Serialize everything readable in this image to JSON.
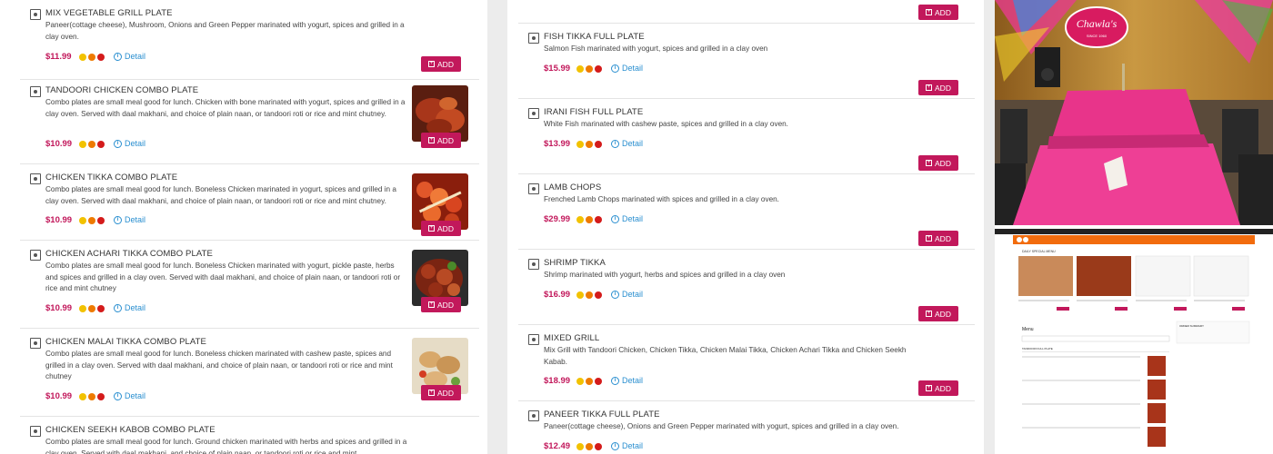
{
  "left_items": [
    {
      "name": "MIX VEGETABLE GRILL PLATE",
      "desc": "Paneer(cottage cheese), Mushroom, Onions and Green Pepper marinated with yogurt, spices and grilled in a clay oven.",
      "price": "$11.99",
      "detail": "Detail",
      "add": "ADD"
    },
    {
      "name": "TANDOORI CHICKEN COMBO PLATE",
      "desc": "Combo plates are small meal good for lunch. Chicken with bone marinated with yogurt, spices and grilled in a clay oven. Served with daal makhani, and choice of plain naan, or tandoori roti or rice and mint chutney.",
      "price": "$10.99",
      "detail": "Detail",
      "add": "ADD"
    },
    {
      "name": "CHICKEN TIKKA COMBO PLATE",
      "desc": "Combo plates are small meal good for lunch. Boneless Chicken marinated in yogurt, spices and grilled in a clay oven. Served with daal makhani, and choice of plain naan, or tandoori roti or rice and mint chutney.",
      "price": "$10.99",
      "detail": "Detail",
      "add": "ADD"
    },
    {
      "name": "CHICKEN ACHARI TIKKA COMBO PLATE",
      "desc": "Combo plates are small meal good for lunch. Boneless Chicken marinated with yogurt, pickle paste, herbs and spices and grilled in a clay oven. Served with daal makhani, and choice of plain naan, or tandoori roti or rice and mint chutney",
      "price": "$10.99",
      "detail": "Detail",
      "add": "ADD"
    },
    {
      "name": "CHICKEN MALAI TIKKA COMBO PLATE",
      "desc": "Combo plates are small meal good for lunch. Boneless chicken marinated with cashew paste, spices and grilled in a clay oven. Served with daal makhani, and choice of plain naan, or tandoori roti or rice and mint chutney",
      "price": "$10.99",
      "detail": "Detail",
      "add": "ADD"
    },
    {
      "name": "CHICKEN SEEKH KABOB COMBO PLATE",
      "desc": "Combo plates are small meal good for lunch. Ground chicken marinated with herbs and spices and grilled in a clay oven. Served with daal makhani, and choice of plain naan, or tandoori roti or rice and mint",
      "price": "",
      "detail": "",
      "add": ""
    }
  ],
  "mid_top_add": "ADD",
  "mid_items": [
    {
      "name": "FISH TIKKA FULL PLATE",
      "desc": "Salmon Fish marinated with yogurt, spices and grilled in a clay oven",
      "price": "$15.99",
      "detail": "Detail",
      "add": "ADD"
    },
    {
      "name": "IRANI FISH FULL PLATE",
      "desc": "White Fish marinated with cashew paste, spices and grilled in a clay oven.",
      "price": "$13.99",
      "detail": "Detail",
      "add": "ADD"
    },
    {
      "name": "LAMB CHOPS",
      "desc": "Frenched Lamb Chops marinated with spices and grilled in a clay oven.",
      "price": "$29.99",
      "detail": "Detail",
      "add": "ADD"
    },
    {
      "name": "SHRIMP TIKKA",
      "desc": "Shrimp marinated with yogurt, herbs and spices and grilled in a clay oven",
      "price": "$16.99",
      "detail": "Detail",
      "add": "ADD"
    },
    {
      "name": "MIXED GRILL",
      "desc": "Mix Grill with Tandoori Chicken, Chicken Tikka, Chicken Malai Tikka, Chicken Achari Tikka and Chicken Seekh Kabab.",
      "price": "$18.99",
      "detail": "Detail",
      "add": "ADD"
    },
    {
      "name": "PANEER TIKKA FULL PLATE",
      "desc": "Paneer(cottage cheese), Onions and Green Pepper marinated with yogurt, spices and grilled in a clay oven.",
      "price": "$12.49",
      "detail": "Detail",
      "add": ""
    }
  ],
  "photo": {
    "sign_text": "Chawla's",
    "sign_sub": "SINCE 1960"
  },
  "mini": {
    "daily_label": "DAILY SPECIAL MENU",
    "menu_label": "Menu",
    "order_label": "ORDER SUMMARY",
    "category_label": "TANDOORI FULL PLATE"
  },
  "colors": {
    "accent": "#c2185b",
    "link": "#2a8fd0",
    "mini_bar": "#f26c0d"
  }
}
